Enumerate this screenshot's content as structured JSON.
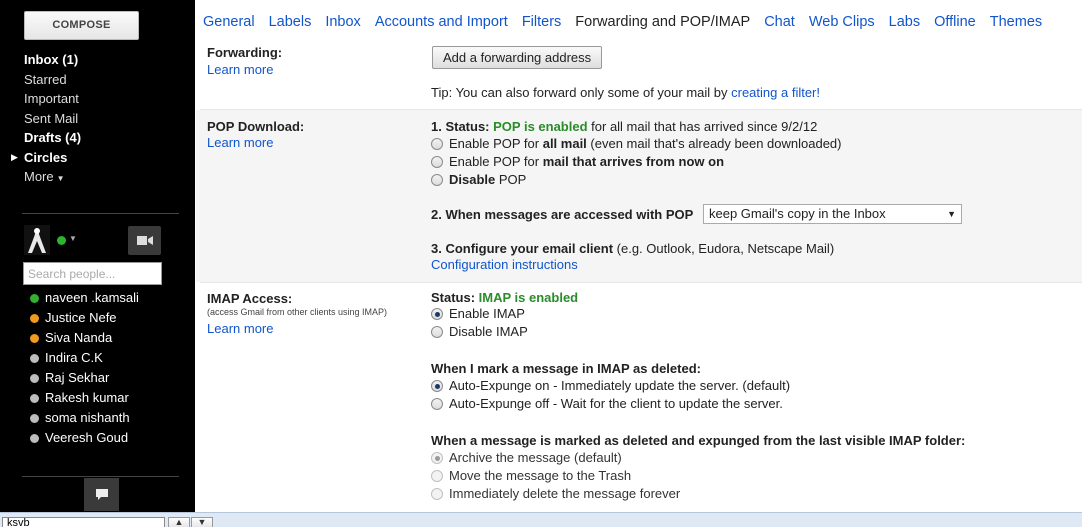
{
  "sidebar": {
    "compose_label": "COMPOSE",
    "nav": [
      {
        "label": "Inbox (1)",
        "bold": true
      },
      {
        "label": "Starred",
        "bold": false
      },
      {
        "label": "Important",
        "bold": false
      },
      {
        "label": "Sent Mail",
        "bold": false
      },
      {
        "label": "Drafts (4)",
        "bold": true
      },
      {
        "label": "Circles",
        "bold": true
      },
      {
        "label": "More",
        "bold": false
      }
    ],
    "search_placeholder": "Search people...",
    "contacts": [
      {
        "name": "naveen .kamsali",
        "status": "green"
      },
      {
        "name": "Justice Nefe",
        "status": "orange"
      },
      {
        "name": "Siva Nanda",
        "status": "orange"
      },
      {
        "name": "Indira C.K",
        "status": "grey"
      },
      {
        "name": "Raj Sekhar",
        "status": "grey"
      },
      {
        "name": "Rakesh kumar",
        "status": "grey"
      },
      {
        "name": "soma nishanth",
        "status": "grey"
      },
      {
        "name": "Veeresh Goud",
        "status": "grey"
      }
    ]
  },
  "tabs": [
    "General",
    "Labels",
    "Inbox",
    "Accounts and Import",
    "Filters",
    "Forwarding and POP/IMAP",
    "Chat",
    "Web Clips",
    "Labs",
    "Offline",
    "Themes"
  ],
  "active_tab": "Forwarding and POP/IMAP",
  "forwarding": {
    "label": "Forwarding:",
    "learn_more": "Learn more",
    "button": "Add a forwarding address",
    "tip_prefix": "Tip: You can also forward only some of your mail by ",
    "tip_link": "creating a filter!"
  },
  "pop": {
    "label": "POP Download:",
    "learn_more": "Learn more",
    "status_prefix": "1. Status: ",
    "status_value": "POP is enabled",
    "status_suffix": " for all mail that has arrived since 9/2/12",
    "opt1_prefix": "Enable POP for ",
    "opt1_bold": "all mail",
    "opt1_suffix": " (even mail that's already been downloaded)",
    "opt2_prefix": "Enable POP for ",
    "opt2_bold": "mail that arrives from now on",
    "opt3_bold": "Disable",
    "opt3_suffix": " POP",
    "step2": "2. When messages are accessed with POP",
    "select_value": "keep Gmail's copy in the Inbox",
    "step3_bold": "3. Configure your email client",
    "step3_suffix": " (e.g. Outlook, Eudora, Netscape Mail)",
    "config_link": "Configuration instructions"
  },
  "imap": {
    "label": "IMAP Access:",
    "sub": "(access Gmail from other clients using IMAP)",
    "learn_more": "Learn more",
    "status_prefix": "Status: ",
    "status_value": "IMAP is enabled",
    "enable": "Enable IMAP",
    "disable": "Disable IMAP",
    "deleted_heading": "When I mark a message in IMAP as deleted:",
    "expunge_on": "Auto-Expunge on - Immediately update the server. (default)",
    "expunge_off": "Auto-Expunge off - Wait for the client to update the server.",
    "expunged_heading": "When a message is marked as deleted and expunged from the last visible IMAP folder:",
    "archive": "Archive the message (default)",
    "trash": "Move the message to the Trash",
    "delete_forever": "Immediately delete the message forever"
  },
  "bottom_bar": {
    "input_value": "ksvb"
  }
}
